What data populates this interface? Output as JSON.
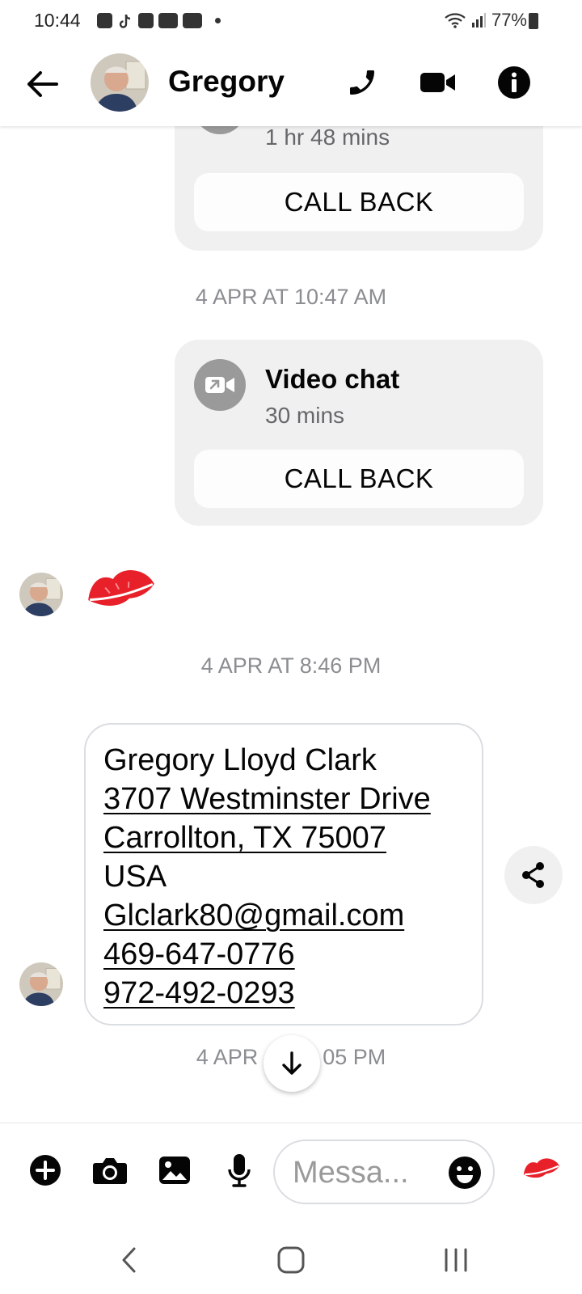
{
  "status_bar": {
    "time": "10:44",
    "battery": "77%"
  },
  "header": {
    "contact_name": "Gregory"
  },
  "messages": {
    "call1": {
      "duration": "1 hr 48 mins",
      "action": "CALL BACK"
    },
    "timestamp1": "4 APR AT 10:47 AM",
    "call2": {
      "title": "Video chat",
      "duration": "30 mins",
      "action": "CALL BACK"
    },
    "timestamp2": "4 APR AT 8:46 PM",
    "address_lines": [
      "Gregory Lloyd Clark",
      "3707 Westminster Drive",
      "Carrollton, TX 75007",
      "USA",
      "Glclark80@gmail.com",
      "469-647-0776",
      "972-492-0293"
    ],
    "timestamp3_left": "4 APR",
    "timestamp3_right": "05 PM"
  },
  "composer": {
    "placeholder": "Messa..."
  },
  "colors": {
    "kiss_red": "#e8202a",
    "bubble_gray": "#f0f0f0",
    "muted_text": "#8a8d91"
  }
}
